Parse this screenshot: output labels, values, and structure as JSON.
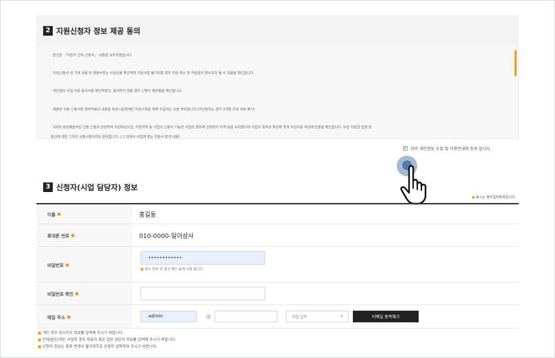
{
  "section2": {
    "number": "2",
    "title": "지원신청자 정보 제공 동의",
    "lines": [
      "· 본인은 「지원자 신퇴 신청서」 내용을 숙지하였습니다.",
      "· 지원신청서 내 기재 내용 및 제출서류는 사실임을 확인하며 지원사업 불가피할 경우 지원 취소 및 지원금의 환수조치 될 수 있음을 확인합니다.",
      "· 개인정보 수집·이용 동의서를 확인하였고, 동의하지 않을 경우 신청이 제한됨을 확인합니다.",
      "· 제출한 지원 신청서와 첨부작료의 내용을 화성시문화재단 지원구축을 위해 수집하는 것을 허락합니다.(미선정되는 경우 3개월 이내 자료 폐기)",
      "· 2025 화성예술지원 신청 신청과 관련하여 지원대상사업, 지원자격 등 사업의 신청이 가능한 사업의 범위에 선정되의 자격 등을 숙지했으며 사업의 목적과 특성에 맞게 지원서를 작성에 빈출을 확인합니다. 또한 지원금 집행 및",
      "정산에 대한 그외의 규정사항이라도 준비합니다. (그 외에서 사업에 맞는 지원서 맞게 내용)"
    ],
    "agree_check": "✔",
    "agree_label": "위의 개인정보 수집 및 이용안내에 동의 합니다."
  },
  "section3": {
    "number": "3",
    "title": "신청자(시업 담당자) 정보",
    "required_dot": "●",
    "required_note": "표시는 필수입력항목입니다.",
    "fields": {
      "name_label": "이름",
      "name_value": "홍길동",
      "phone_label": "휴대폰 번호",
      "phone_value": "010-0000-일이삼사",
      "password_label": "비밀번호",
      "password_value": "••••••••••••",
      "password_hint": "접수 추회 및 결과 확인 등에 사용 됩니다.",
      "password_confirm_label": "비밀번호 확인",
      "email_label": "메일 주소",
      "email_id": "admin",
      "email_at": "@",
      "email_select": "직접 입력",
      "email_select_arrow": "▾",
      "email_button": "이메일 중복체크"
    },
    "notes": [
      "개인 경우 당시지의 정보를 입력해 주시기 바랍니다.",
      "단체/법인/개인 사업자 경우 대표자 혹은 업무 담당자 정보를 입력해 주시기 바랍니다.",
      "신청자 정보는 향후 변경이 불가하므로 신중히 입력하여 주시기 바랍니다."
    ],
    "note_marker": "■"
  },
  "colors": {
    "accent": "#f39c12",
    "pointer": "#5a82af",
    "button": "#222222",
    "autofill": "#e8f0fe"
  },
  "icons": {
    "pointer": "hand-pointer-icon",
    "check": "checkbox-icon"
  }
}
